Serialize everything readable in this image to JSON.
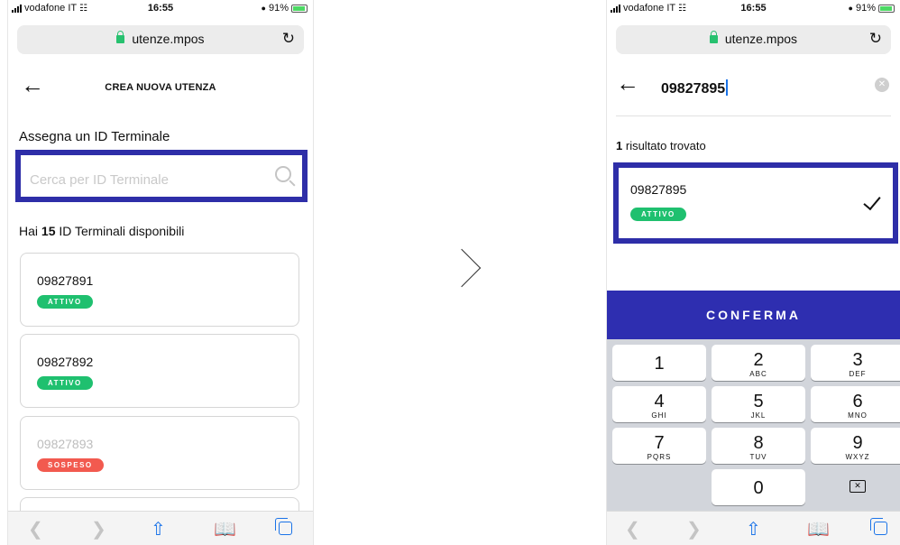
{
  "status_bar": {
    "carrier": "vodafone IT",
    "time": "16:55",
    "battery": "91%"
  },
  "url_bar": {
    "domain": "utenze.mpos"
  },
  "left_screen": {
    "title": "CREA NUOVA UTENZA",
    "section_title": "Assegna un ID Terminale",
    "search_placeholder": "Cerca per ID Terminale",
    "available_prefix": "Hai",
    "available_count": "15",
    "available_suffix": "ID Terminali disponibili",
    "terminals": [
      {
        "id": "09827891",
        "status": "ATTIVO"
      },
      {
        "id": "09827892",
        "status": "ATTIVO"
      },
      {
        "id": "09827893",
        "status": "SOSPESO"
      }
    ]
  },
  "right_screen": {
    "search_value": "09827895",
    "result_count": "1",
    "result_label": "risultato trovato",
    "result": {
      "id": "09827895",
      "status": "ATTIVO"
    },
    "confirm_label": "CONFERMA",
    "keypad": [
      {
        "digit": "1",
        "letters": ""
      },
      {
        "digit": "2",
        "letters": "ABC"
      },
      {
        "digit": "3",
        "letters": "DEF"
      },
      {
        "digit": "4",
        "letters": "GHI"
      },
      {
        "digit": "5",
        "letters": "JKL"
      },
      {
        "digit": "6",
        "letters": "MNO"
      },
      {
        "digit": "7",
        "letters": "PQRS"
      },
      {
        "digit": "8",
        "letters": "TUV"
      },
      {
        "digit": "9",
        "letters": "WXYZ"
      },
      {
        "digit": "0",
        "letters": ""
      }
    ]
  },
  "colors": {
    "accent": "#2e2eb0",
    "active": "#1fc06f",
    "suspended": "#f25a4f",
    "safari_blue": "#1a73e8"
  },
  "icons": {
    "back": "arrow-left-icon",
    "search": "search-icon",
    "check": "check-icon",
    "clear": "clear-icon",
    "share": "share-icon",
    "bookmarks": "book-icon",
    "tabs": "tabs-icon",
    "chevron": "chevron-right-icon"
  }
}
